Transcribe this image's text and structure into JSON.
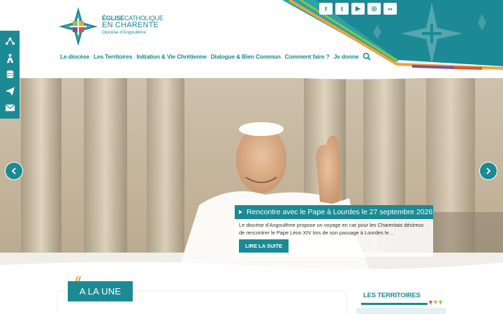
{
  "colors": {
    "teal": "#1c8a94",
    "accent_orange": "#f0a23a",
    "accent_green": "#8cc63f",
    "accent_purple": "#7a4f9c"
  },
  "logo": {
    "line1_bold": "ÉGLISE",
    "line1_thin": "CATHOLIQUE",
    "line2": "EN CHARENTE",
    "line3": "Diocèse d'Angoulême"
  },
  "social": [
    {
      "icon": "facebook-icon",
      "glyph": "f"
    },
    {
      "icon": "twitter-icon",
      "glyph": "t"
    },
    {
      "icon": "youtube-icon",
      "glyph": "▶"
    },
    {
      "icon": "instagram-icon",
      "glyph": "◎"
    },
    {
      "icon": "flickr-icon",
      "glyph": "••"
    }
  ],
  "nav": {
    "items": [
      "Le diocèse",
      "Les Territoires",
      "Initiation & Vie Chrétienne",
      "Dialogue & Bien Commun",
      "Comment faire ?",
      "Je donne"
    ],
    "search_icon": "search-icon"
  },
  "sidebar": [
    "map-icon",
    "praying-icon",
    "coins-icon",
    "send-icon",
    "mail-icon"
  ],
  "hero": {
    "title": "Rencontre avec le Pape à Lourdes le 27 septembre 2026",
    "text": "Le diocèse d'Angoulême propose un voyage en car pour les Charentais désireux de rencontrer le Pape Léon XIV lors de son passage à Lourdes le…",
    "button": "LIRE LA SUITE"
  },
  "sections": {
    "une": "A LA UNE",
    "territoires": "LES TERRITOIRES"
  }
}
